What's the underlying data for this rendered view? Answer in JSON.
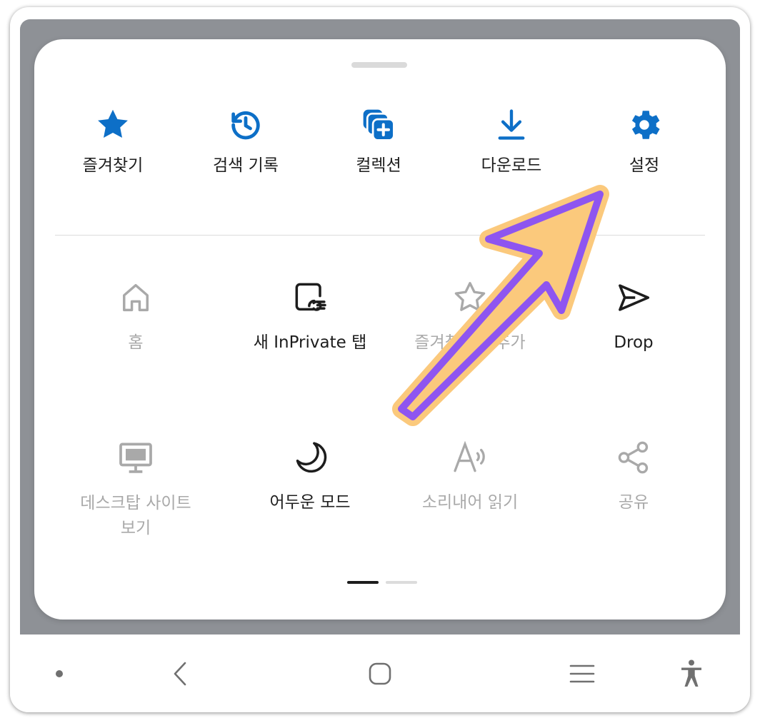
{
  "quick_actions": [
    {
      "label": "즐겨찾기",
      "icon": "star-icon"
    },
    {
      "label": "검색 기록",
      "icon": "history-icon"
    },
    {
      "label": "컬렉션",
      "icon": "collections-icon"
    },
    {
      "label": "다운로드",
      "icon": "download-icon"
    },
    {
      "label": "설정",
      "icon": "settings-gear-icon"
    }
  ],
  "menu_items": [
    {
      "label": "홈",
      "icon": "home-icon",
      "enabled": false
    },
    {
      "label": "새 InPrivate 탭",
      "icon": "inprivate-tab-icon",
      "enabled": true
    },
    {
      "label": "즐겨찾기에 추가",
      "icon": "star-add-icon",
      "enabled": false
    },
    {
      "label": "Drop",
      "icon": "send-icon",
      "enabled": true
    },
    {
      "label_line1": "데스크탑 사이트",
      "label_line2": "보기",
      "icon": "desktop-icon",
      "enabled": false
    },
    {
      "label": "어두운 모드",
      "icon": "moon-icon",
      "enabled": true
    },
    {
      "label": "소리내어 읽기",
      "icon": "read-aloud-icon",
      "enabled": false
    },
    {
      "label": "공유",
      "icon": "share-icon",
      "enabled": false
    }
  ],
  "pagination": {
    "pages": 2,
    "current": 1
  },
  "navbar": [
    "dot-icon",
    "back-icon",
    "home-icon",
    "recents-icon",
    "accessibility-icon"
  ],
  "colors": {
    "accent": "#0d6fc7",
    "annotation_fill": "#fbc97c",
    "annotation_stroke": "#8e55f0",
    "disabled": "#a9a9a9"
  }
}
